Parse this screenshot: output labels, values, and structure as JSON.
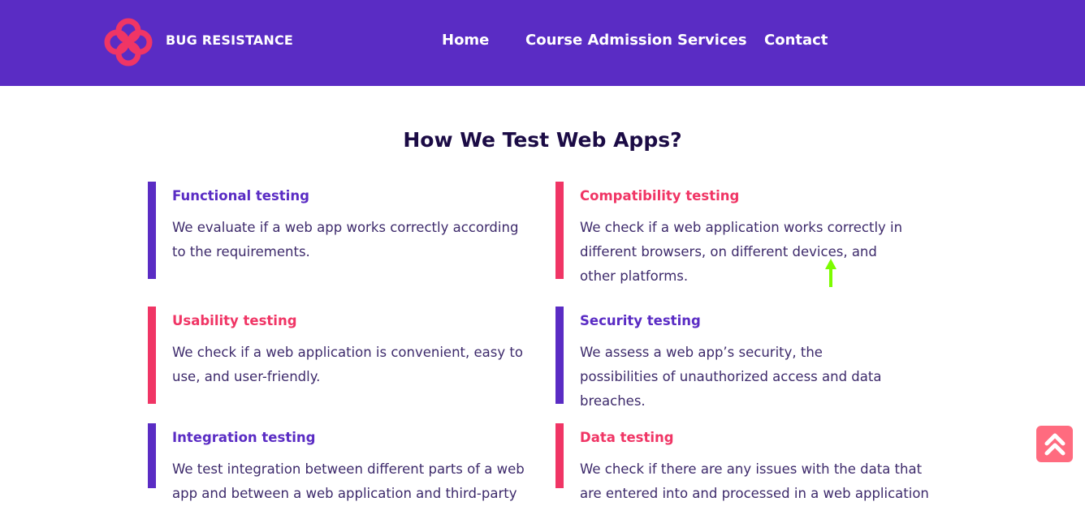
{
  "colors": {
    "brand": "#5a2cc4",
    "accent": "#f03565",
    "accent_light": "#ff6b7f",
    "title": "#1b0b45",
    "text": "#3d2a6b"
  },
  "header": {
    "logo_icon": "clover-logo-icon",
    "brand_name": "BUG RESISTANCE",
    "nav": {
      "home": "Home",
      "course_admission": "Course Admission",
      "services": "Services",
      "contact": "Contact"
    }
  },
  "main": {
    "title": "How We Test Web Apps?",
    "cards": [
      {
        "title": "Functional testing",
        "desc": "We evaluate if a web app works correctly according to the requirements.",
        "color": "#5a2cc4"
      },
      {
        "title": "Compatibility testing",
        "desc": "We check if a web application works correctly in different browsers, on different devices, and other platforms.",
        "color": "#f03565"
      },
      {
        "title": "Usability testing",
        "desc": "We check if a web application is convenient, easy to use, and user-friendly.",
        "color": "#f03565"
      },
      {
        "title": "Security testing",
        "desc": "We assess a web app’s security, the possibilities of unauthorized access and data breaches.",
        "color": "#5a2cc4"
      },
      {
        "title": "Integration testing",
        "desc": "We test integration between different parts of a web app and between a web application and third-party",
        "color": "#5a2cc4"
      },
      {
        "title": "Data testing",
        "desc": "We check if there are any issues with the data that are entered into and processed in a web application",
        "color": "#f03565"
      }
    ]
  },
  "scroll_top_icon": "double-chevron-up-icon"
}
